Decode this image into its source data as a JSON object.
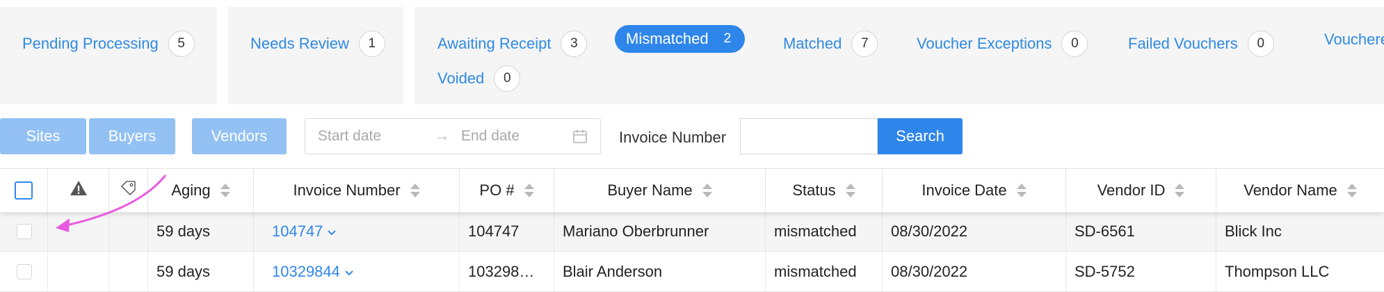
{
  "tabs": [
    {
      "label": "Pending Processing",
      "count": "5"
    },
    {
      "label": "Needs Review",
      "count": "1"
    },
    {
      "label": "Awaiting Receipt",
      "count": "3"
    },
    {
      "label": "Mismatched",
      "count": "2",
      "active": true
    },
    {
      "label": "Matched",
      "count": "7"
    },
    {
      "label": "Voucher Exceptions",
      "count": "0"
    },
    {
      "label": "Failed Vouchers",
      "count": "0"
    },
    {
      "label": "Vouchered",
      "count": ""
    },
    {
      "label": "Voided",
      "count": "0"
    }
  ],
  "filters": {
    "sites": "Sites",
    "buyers": "Buyers",
    "vendors": "Vendors",
    "start_placeholder": "Start date",
    "end_placeholder": "End date",
    "invoice_label": "Invoice Number",
    "invoice_value": "",
    "search": "Search"
  },
  "table": {
    "headers": {
      "aging": "Aging",
      "invoice_number": "Invoice Number",
      "po": "PO #",
      "buyer": "Buyer Name",
      "status": "Status",
      "invoice_date": "Invoice Date",
      "vendor_id": "Vendor ID",
      "vendor_name": "Vendor Name"
    },
    "rows": [
      {
        "aging": "59 days",
        "invoice_number": "104747",
        "po": "104747",
        "buyer": "Mariano Oberbrunner",
        "status": "mismatched",
        "invoice_date": "08/30/2022",
        "vendor_id": "SD-6561",
        "vendor_name": "Blick Inc"
      },
      {
        "aging": "59 days",
        "invoice_number": "10329844",
        "po": "103298…",
        "buyer": "Blair Anderson",
        "status": "mismatched",
        "invoice_date": "08/30/2022",
        "vendor_id": "SD-5752",
        "vendor_name": "Thompson LLC"
      }
    ]
  },
  "colors": {
    "accent": "#2f86ea",
    "light_button": "#93c1f3",
    "annotation_arrow": "#e85ae0"
  }
}
